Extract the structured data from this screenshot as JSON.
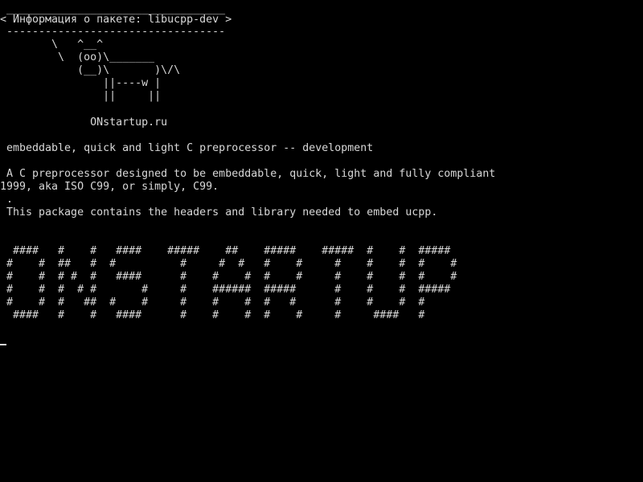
{
  "terminal": {
    "background": "#000000",
    "foreground": "#d8d8d8",
    "cowsay": {
      "border_top": " __________________________________",
      "message": "< Информация о пакете: libucpp-dev >",
      "border_bottom": " ----------------------------------",
      "cow": [
        "        \\   ^__^",
        "         \\  (oo)\\_______",
        "            (__)\\       )\\/\\",
        "                ||----w |",
        "                ||     ||"
      ]
    },
    "site": "              ONstartup.ru",
    "description_short": " embeddable, quick and light C preprocessor -- development",
    "description_long": [
      " A C preprocessor designed to be embeddable, quick, light and fully compliant",
      "1999, aka ISO C99, or simply, C99.",
      " .",
      " This package contains the headers and library needed to embed ucpp."
    ],
    "banner": [
      "  ####   #    #   ####    #####    ##    #####    #####  #    #  #####",
      " #    #  ##   #  #          #     #  #   #    #     #    #    #  #    #",
      " #    #  # #  #   ####      #    #    #  #    #     #    #    #  #    #",
      " #    #  #  # #       #     #    ######  #####      #    #    #  #####",
      " #    #  #   ##  #    #     #    #    #  #   #      #    #    #  #",
      "  ####   #    #   ####      #    #    #  #    #     #     ####   #"
    ]
  }
}
